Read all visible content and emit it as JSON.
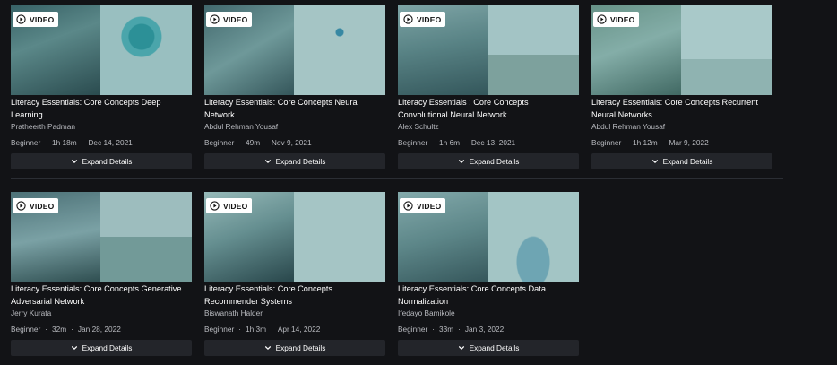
{
  "badge_label": "VIDEO",
  "expand_label": "Expand Details",
  "cards": [
    {
      "title": "Literacy Essentials: Core Concepts Deep Learning",
      "author": "Pratheerth Padman",
      "level": "Beginner",
      "duration": "1h 18m",
      "date": "Dec 14, 2021"
    },
    {
      "title": "Literacy Essentials: Core Concepts Neural Network",
      "author": "Abdul Rehman Yousaf",
      "level": "Beginner",
      "duration": "49m",
      "date": "Nov 9, 2021"
    },
    {
      "title": "Literacy Essentials : Core Concepts Convolutional Neural Network",
      "author": "Alex Schultz",
      "level": "Beginner",
      "duration": "1h 6m",
      "date": "Dec 13, 2021"
    },
    {
      "title": "Literacy Essentials: Core Concepts Recurrent Neural Networks",
      "author": "Abdul Rehman Yousaf",
      "level": "Beginner",
      "duration": "1h 12m",
      "date": "Mar 9, 2022"
    },
    {
      "title": "Literacy Essentials: Core Concepts Generative Adversarial Network",
      "author": "Jerry Kurata",
      "level": "Beginner",
      "duration": "32m",
      "date": "Jan 28, 2022"
    },
    {
      "title": "Literacy Essentials: Core Concepts Recommender Systems",
      "author": "Biswanath Halder",
      "level": "Beginner",
      "duration": "1h 3m",
      "date": "Apr 14, 2022"
    },
    {
      "title": "Literacy Essentials: Core Concepts Data Normalization",
      "author": "Ifedayo Bamikole",
      "level": "Beginner",
      "duration": "33m",
      "date": "Jan 3, 2022"
    }
  ],
  "colors": {
    "background": "#121316",
    "button_bg": "#23252a",
    "meta_text": "#b9bbc0",
    "thumb_tint": "#2f8a92"
  }
}
